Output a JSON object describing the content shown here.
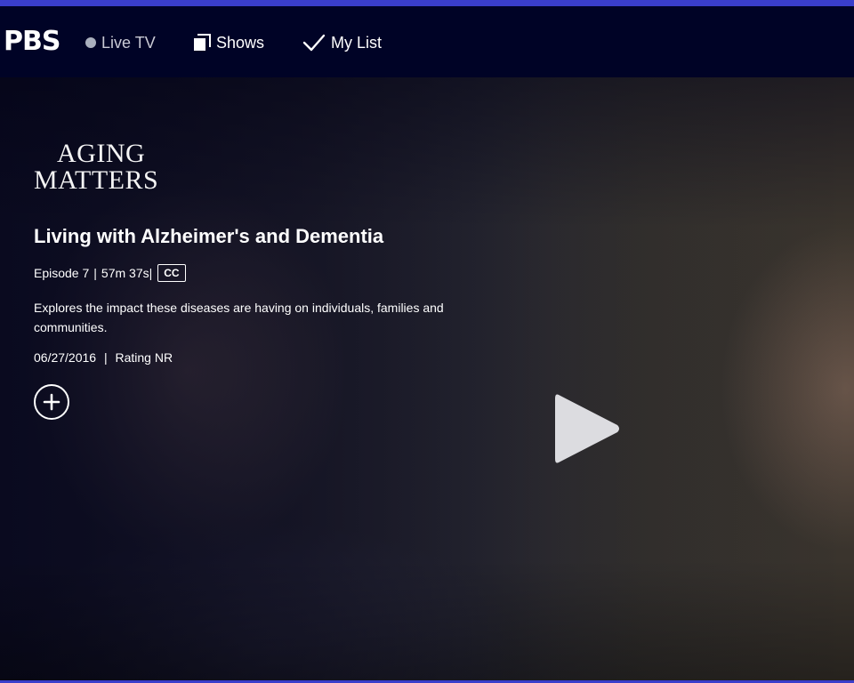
{
  "nav": {
    "logo": "PBS",
    "live_tv": "Live TV",
    "shows": "Shows",
    "my_list": "My List"
  },
  "show": {
    "logo_line1": "AGING",
    "logo_line2": "MATTERS"
  },
  "episode": {
    "title": "Living with Alzheimer's and Dementia",
    "episode_label": "Episode 7",
    "duration": "57m 37s",
    "cc": "CC",
    "description": "Explores the impact these diseases are having on individuals, families and communities.",
    "date": "06/27/2016",
    "rating": "Rating NR",
    "separator": "|"
  },
  "icons": {
    "live": "live-dot-icon",
    "shows": "shows-icon",
    "my_list": "check-icon",
    "add": "plus-icon",
    "play": "play-icon"
  },
  "colors": {
    "accent": "#3a3ecb",
    "nav_bg": "#000326",
    "live_dot": "#aab0be"
  }
}
